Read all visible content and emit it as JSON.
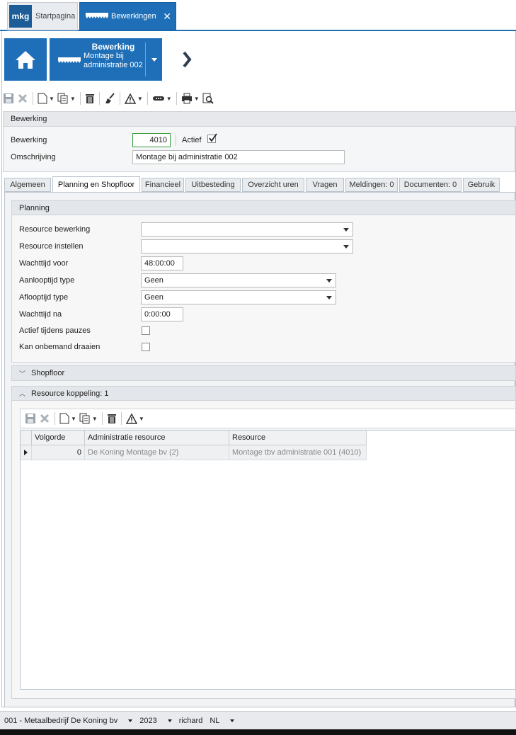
{
  "top_tabs": {
    "start": {
      "logo": "mkg",
      "label": "Startpagina"
    },
    "bewerkingen": {
      "label": "Bewerkingen"
    }
  },
  "header": {
    "tile_title": "Bewerking",
    "tile_subtitle": "Montage bij administratie 002"
  },
  "bewerking_panel": {
    "title": "Bewerking",
    "bewerking_label": "Bewerking",
    "bewerking_value": "4010",
    "actief_label": "Actief",
    "actief_checked": true,
    "omschrijving_label": "Omschrijving",
    "omschrijving_value": "Montage bij administratie 002"
  },
  "tabs": [
    {
      "label": "Algemeen"
    },
    {
      "label": "Planning en Shopfloor"
    },
    {
      "label": "Financieel"
    },
    {
      "label": "Uitbesteding"
    },
    {
      "label": "Overzicht uren"
    },
    {
      "label": "Vragen"
    },
    {
      "label": "Meldingen: 0"
    },
    {
      "label": "Documenten: 0"
    },
    {
      "label": "Gebruik"
    }
  ],
  "planning": {
    "title": "Planning",
    "resource_bewerking_label": "Resource bewerking",
    "resource_bewerking_value": "",
    "resource_instellen_label": "Resource instellen",
    "resource_instellen_value": "",
    "wachttijd_voor_label": "Wachttijd voor",
    "wachttijd_voor_value": "48:00:00",
    "aanlooptijd_label": "Aanlooptijd type",
    "aanlooptijd_value": "Geen",
    "aflooptijd_label": "Aflooptijd type",
    "aflooptijd_value": "Geen",
    "wachttijd_na_label": "Wachttijd na",
    "wachttijd_na_value": "0:00:00",
    "actief_pauzes_label": "Actief tijdens pauzes",
    "onbemand_label": "Kan onbemand draaien"
  },
  "shopfloor": {
    "title": "Shopfloor"
  },
  "resource_koppeling": {
    "title": "Resource koppeling: 1",
    "columns": [
      "Volgorde",
      "Administratie resource",
      "Resource"
    ],
    "rows": [
      {
        "volgorde": "0",
        "administratie": "De Koning Montage bv (2)",
        "resource": "Montage tbv administratie 001 (4010)"
      }
    ]
  },
  "status_bar": {
    "company": "001 - Metaalbedrijf De Koning bv",
    "year": "2023",
    "user": "richard",
    "lang": "NL"
  },
  "colors": {
    "accent": "#1e6fb8",
    "logo_bg": "#1c5d97"
  }
}
